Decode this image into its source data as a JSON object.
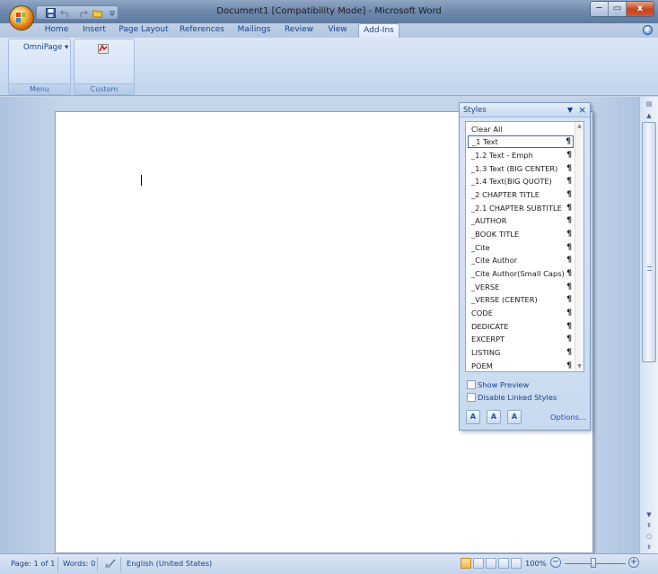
{
  "window": {
    "title": "Document1 [Compatibility Mode] - Microsoft Word",
    "minimize_glyph": "─",
    "restore_glyph": "▭",
    "close_glyph": "x"
  },
  "tabs": [
    {
      "label": "Home"
    },
    {
      "label": "Insert"
    },
    {
      "label": "Page Layout"
    },
    {
      "label": "References"
    },
    {
      "label": "Mailings"
    },
    {
      "label": "Review"
    },
    {
      "label": "View"
    },
    {
      "label": "Add-Ins",
      "active": true
    }
  ],
  "ribbon": {
    "menu_commands": {
      "button_label": "OmniPage ▾",
      "group_label": "Menu Commands"
    },
    "custom_toolbars": {
      "group_label": "Custom Toolbars"
    }
  },
  "styles_pane": {
    "title": "Styles",
    "menu_glyph": "▼",
    "close_glyph": "×",
    "items": [
      {
        "label": "Clear All",
        "mark": ""
      },
      {
        "label": "_1 Text",
        "mark": "¶",
        "selected": true
      },
      {
        "label": "_1.2 Text - Emph",
        "mark": "¶"
      },
      {
        "label": "_1.3 Text (BIG CENTER)",
        "mark": "¶"
      },
      {
        "label": "_1.4 Text(BIG QUOTE)",
        "mark": "¶"
      },
      {
        "label": "_2 CHAPTER TITLE",
        "mark": "¶"
      },
      {
        "label": "_2.1 CHAPTER SUBTITLE",
        "mark": "¶"
      },
      {
        "label": "_AUTHOR",
        "mark": "¶"
      },
      {
        "label": "_BOOK TITLE",
        "mark": "¶"
      },
      {
        "label": "_Cite",
        "mark": "¶"
      },
      {
        "label": "_Cite Author",
        "mark": "¶"
      },
      {
        "label": "_Cite Author(Small Caps)",
        "mark": "¶"
      },
      {
        "label": "_VERSE",
        "mark": "¶"
      },
      {
        "label": "_VERSE (CENTER)",
        "mark": "¶"
      },
      {
        "label": "CODE",
        "mark": "¶"
      },
      {
        "label": "DEDICATE",
        "mark": "¶"
      },
      {
        "label": "EXCERPT",
        "mark": "¶"
      },
      {
        "label": "LISTING",
        "mark": "¶"
      },
      {
        "label": "POEM",
        "mark": "¶"
      }
    ],
    "show_preview_label": "Show Preview",
    "disable_linked_label": "Disable Linked Styles",
    "options_label": "Options...",
    "new_style_glyph": "A",
    "inspector_glyph": "A",
    "manage_glyph": "A"
  },
  "status": {
    "page": "Page: 1 of 1",
    "words": "Words: 0",
    "language": "English (United States)",
    "zoom": "100%"
  },
  "colors": {
    "accent": "#15428b",
    "ribbon": "#c9daf0",
    "page": "#ffffff"
  }
}
